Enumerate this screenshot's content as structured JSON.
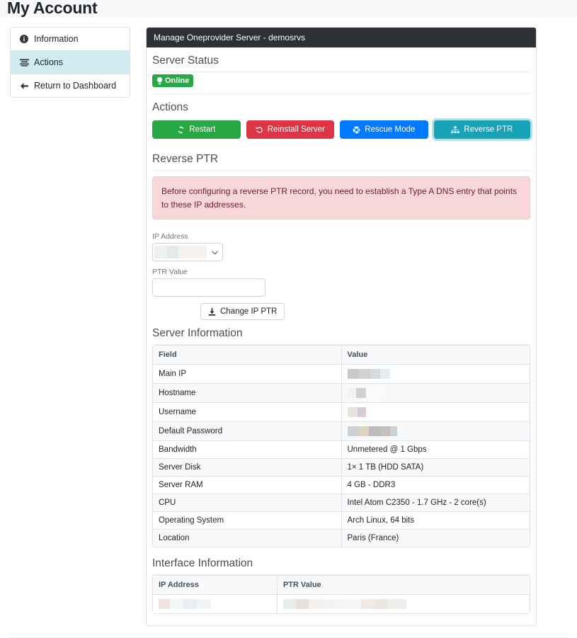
{
  "header": {
    "title": "My Account"
  },
  "sidebar": {
    "items": [
      {
        "label": "Information",
        "icon": "info-circle-icon",
        "active": false
      },
      {
        "label": "Actions",
        "icon": "list-icon",
        "active": true
      },
      {
        "label": "Return to Dashboard",
        "icon": "arrow-left-icon",
        "active": false
      }
    ]
  },
  "card": {
    "header_title": "Manage Oneprovider Server - demosrvs",
    "server_status": {
      "section_title": "Server Status",
      "badge_label": "Online",
      "badge_icon": "lightbulb-icon",
      "badge_color": "#28a745"
    },
    "actions": {
      "section_title": "Actions",
      "buttons": [
        {
          "label": "Restart",
          "icon": "refresh-icon",
          "color": "#28a745",
          "style": "success"
        },
        {
          "label": "Reinstall Server",
          "icon": "undo-icon",
          "color": "#dc3545",
          "style": "danger"
        },
        {
          "label": "Rescue Mode",
          "icon": "life-ring-icon",
          "color": "#007bff",
          "style": "primary"
        },
        {
          "label": "Reverse PTR",
          "icon": "sitemap-icon",
          "color": "#17a2b8",
          "style": "info"
        }
      ]
    },
    "reverse_ptr": {
      "section_title": "Reverse PTR",
      "alert_text": "Before configuring a reverse PTR record, you need to establish a Type A DNS entry that points to these IP addresses.",
      "alert_bg": "#f8d7da",
      "alert_color": "#721c24",
      "ip_label": "IP Address",
      "ip_selected": "2",
      "ip_options": [
        "2"
      ],
      "ptr_label": "PTR Value",
      "ptr_value": "",
      "ptr_placeholder": "",
      "submit_label": "Change IP PTR",
      "submit_icon": "download-icon"
    },
    "server_information": {
      "section_title": "Server Information",
      "columns": [
        "Field",
        "Value"
      ],
      "rows": [
        {
          "field": "Main IP",
          "value": "",
          "redacted": true
        },
        {
          "field": "Hostname",
          "value": "",
          "redacted": true
        },
        {
          "field": "Username",
          "value": "",
          "redacted": true
        },
        {
          "field": "Default Password",
          "value": "",
          "redacted": true
        },
        {
          "field": "Bandwidth",
          "value": "Unmetered @ 1 Gbps",
          "redacted": false
        },
        {
          "field": "Server Disk",
          "value": "1× 1 TB (HDD SATA)",
          "redacted": false
        },
        {
          "field": "Server RAM",
          "value": "4 GB - DDR3",
          "redacted": false
        },
        {
          "field": "CPU",
          "value": "Intel Atom C2350 - 1.7 GHz - 2 core(s)",
          "redacted": false
        },
        {
          "field": "Operating System",
          "value": "Arch Linux, 64 bits",
          "redacted": false
        },
        {
          "field": "Location",
          "value": "Paris (France)",
          "redacted": false
        }
      ]
    },
    "interface_information": {
      "section_title": "Interface Information",
      "columns": [
        "IP Address",
        "PTR Value"
      ],
      "rows": [
        {
          "ip": "",
          "ptr": "",
          "redacted": true
        }
      ]
    }
  }
}
